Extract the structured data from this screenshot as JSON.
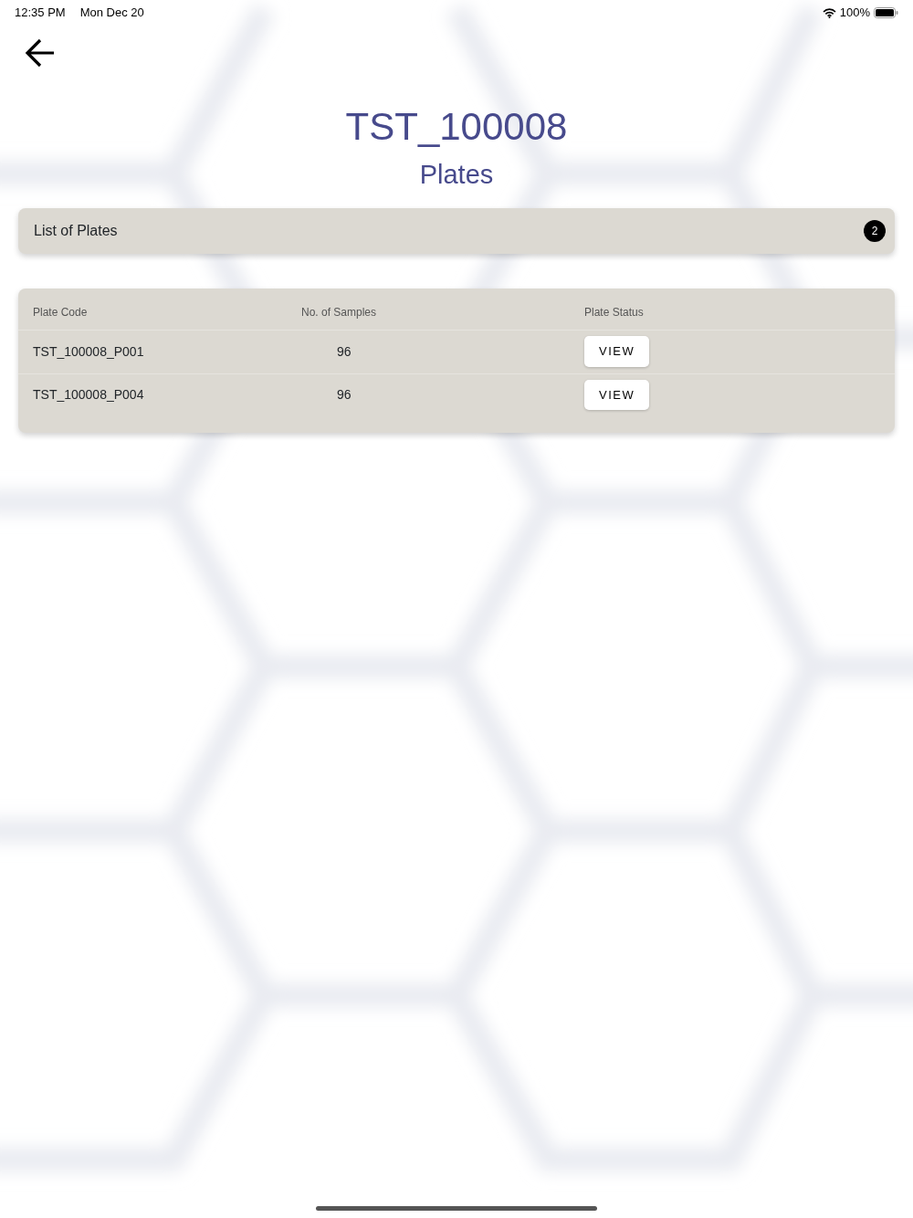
{
  "status_bar": {
    "time": "12:35 PM",
    "date": "Mon Dec 20",
    "battery": "100%"
  },
  "header": {
    "title": "TST_100008",
    "subtitle": "Plates"
  },
  "list_bar": {
    "label": "List of Plates",
    "count": "2"
  },
  "table": {
    "columns": [
      "Plate Code",
      "No. of Samples",
      "Plate Status"
    ],
    "rows": [
      {
        "code": "TST_100008_P001",
        "samples": "96",
        "action": "VIEW"
      },
      {
        "code": "TST_100008_P004",
        "samples": "96",
        "action": "VIEW"
      }
    ]
  }
}
